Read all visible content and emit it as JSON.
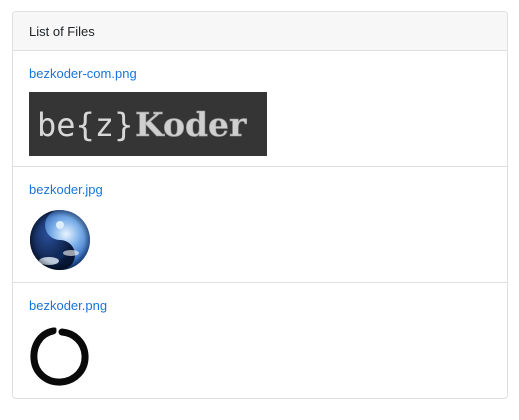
{
  "header": {
    "title": "List of Files"
  },
  "files": [
    {
      "name": "bezkoder-com.png",
      "image_text_left": "be{z}",
      "image_text_right": "Koder",
      "icon": "bezkoder-logo-image"
    },
    {
      "name": "bezkoder.jpg",
      "icon": "yin-yang-sphere-image"
    },
    {
      "name": "bezkoder.png",
      "icon": "enso-circle-image"
    }
  ],
  "colors": {
    "link": "#1a73d9",
    "header_bg": "#f7f7f7",
    "border": "#dfdfdf",
    "logo_bg": "#353535"
  }
}
